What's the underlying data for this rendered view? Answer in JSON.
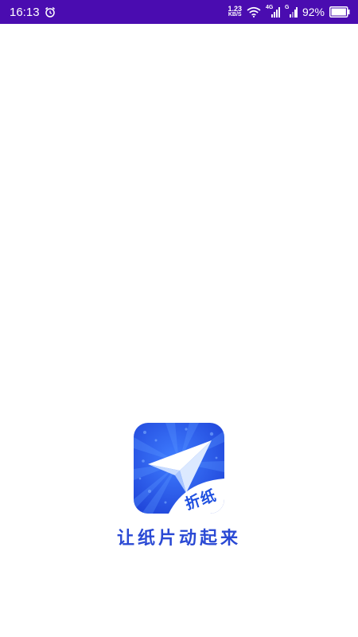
{
  "status_bar": {
    "time": "16:13",
    "alarm_icon": "alarm-clock-icon",
    "net_speed_value": "1.23",
    "net_speed_unit": "KB/S",
    "wifi_icon": "wifi-icon",
    "signal1_tag": "4G",
    "signal2_tag": "G",
    "battery_percent": "92%",
    "battery_icon": "battery-icon"
  },
  "splash": {
    "app_icon_badge": "折纸",
    "slogan": "让纸片动起来"
  },
  "colors": {
    "status_bar_bg": "#4a0cb0",
    "icon_blue": "#2a5cf0",
    "slogan": "#2a49d4"
  }
}
